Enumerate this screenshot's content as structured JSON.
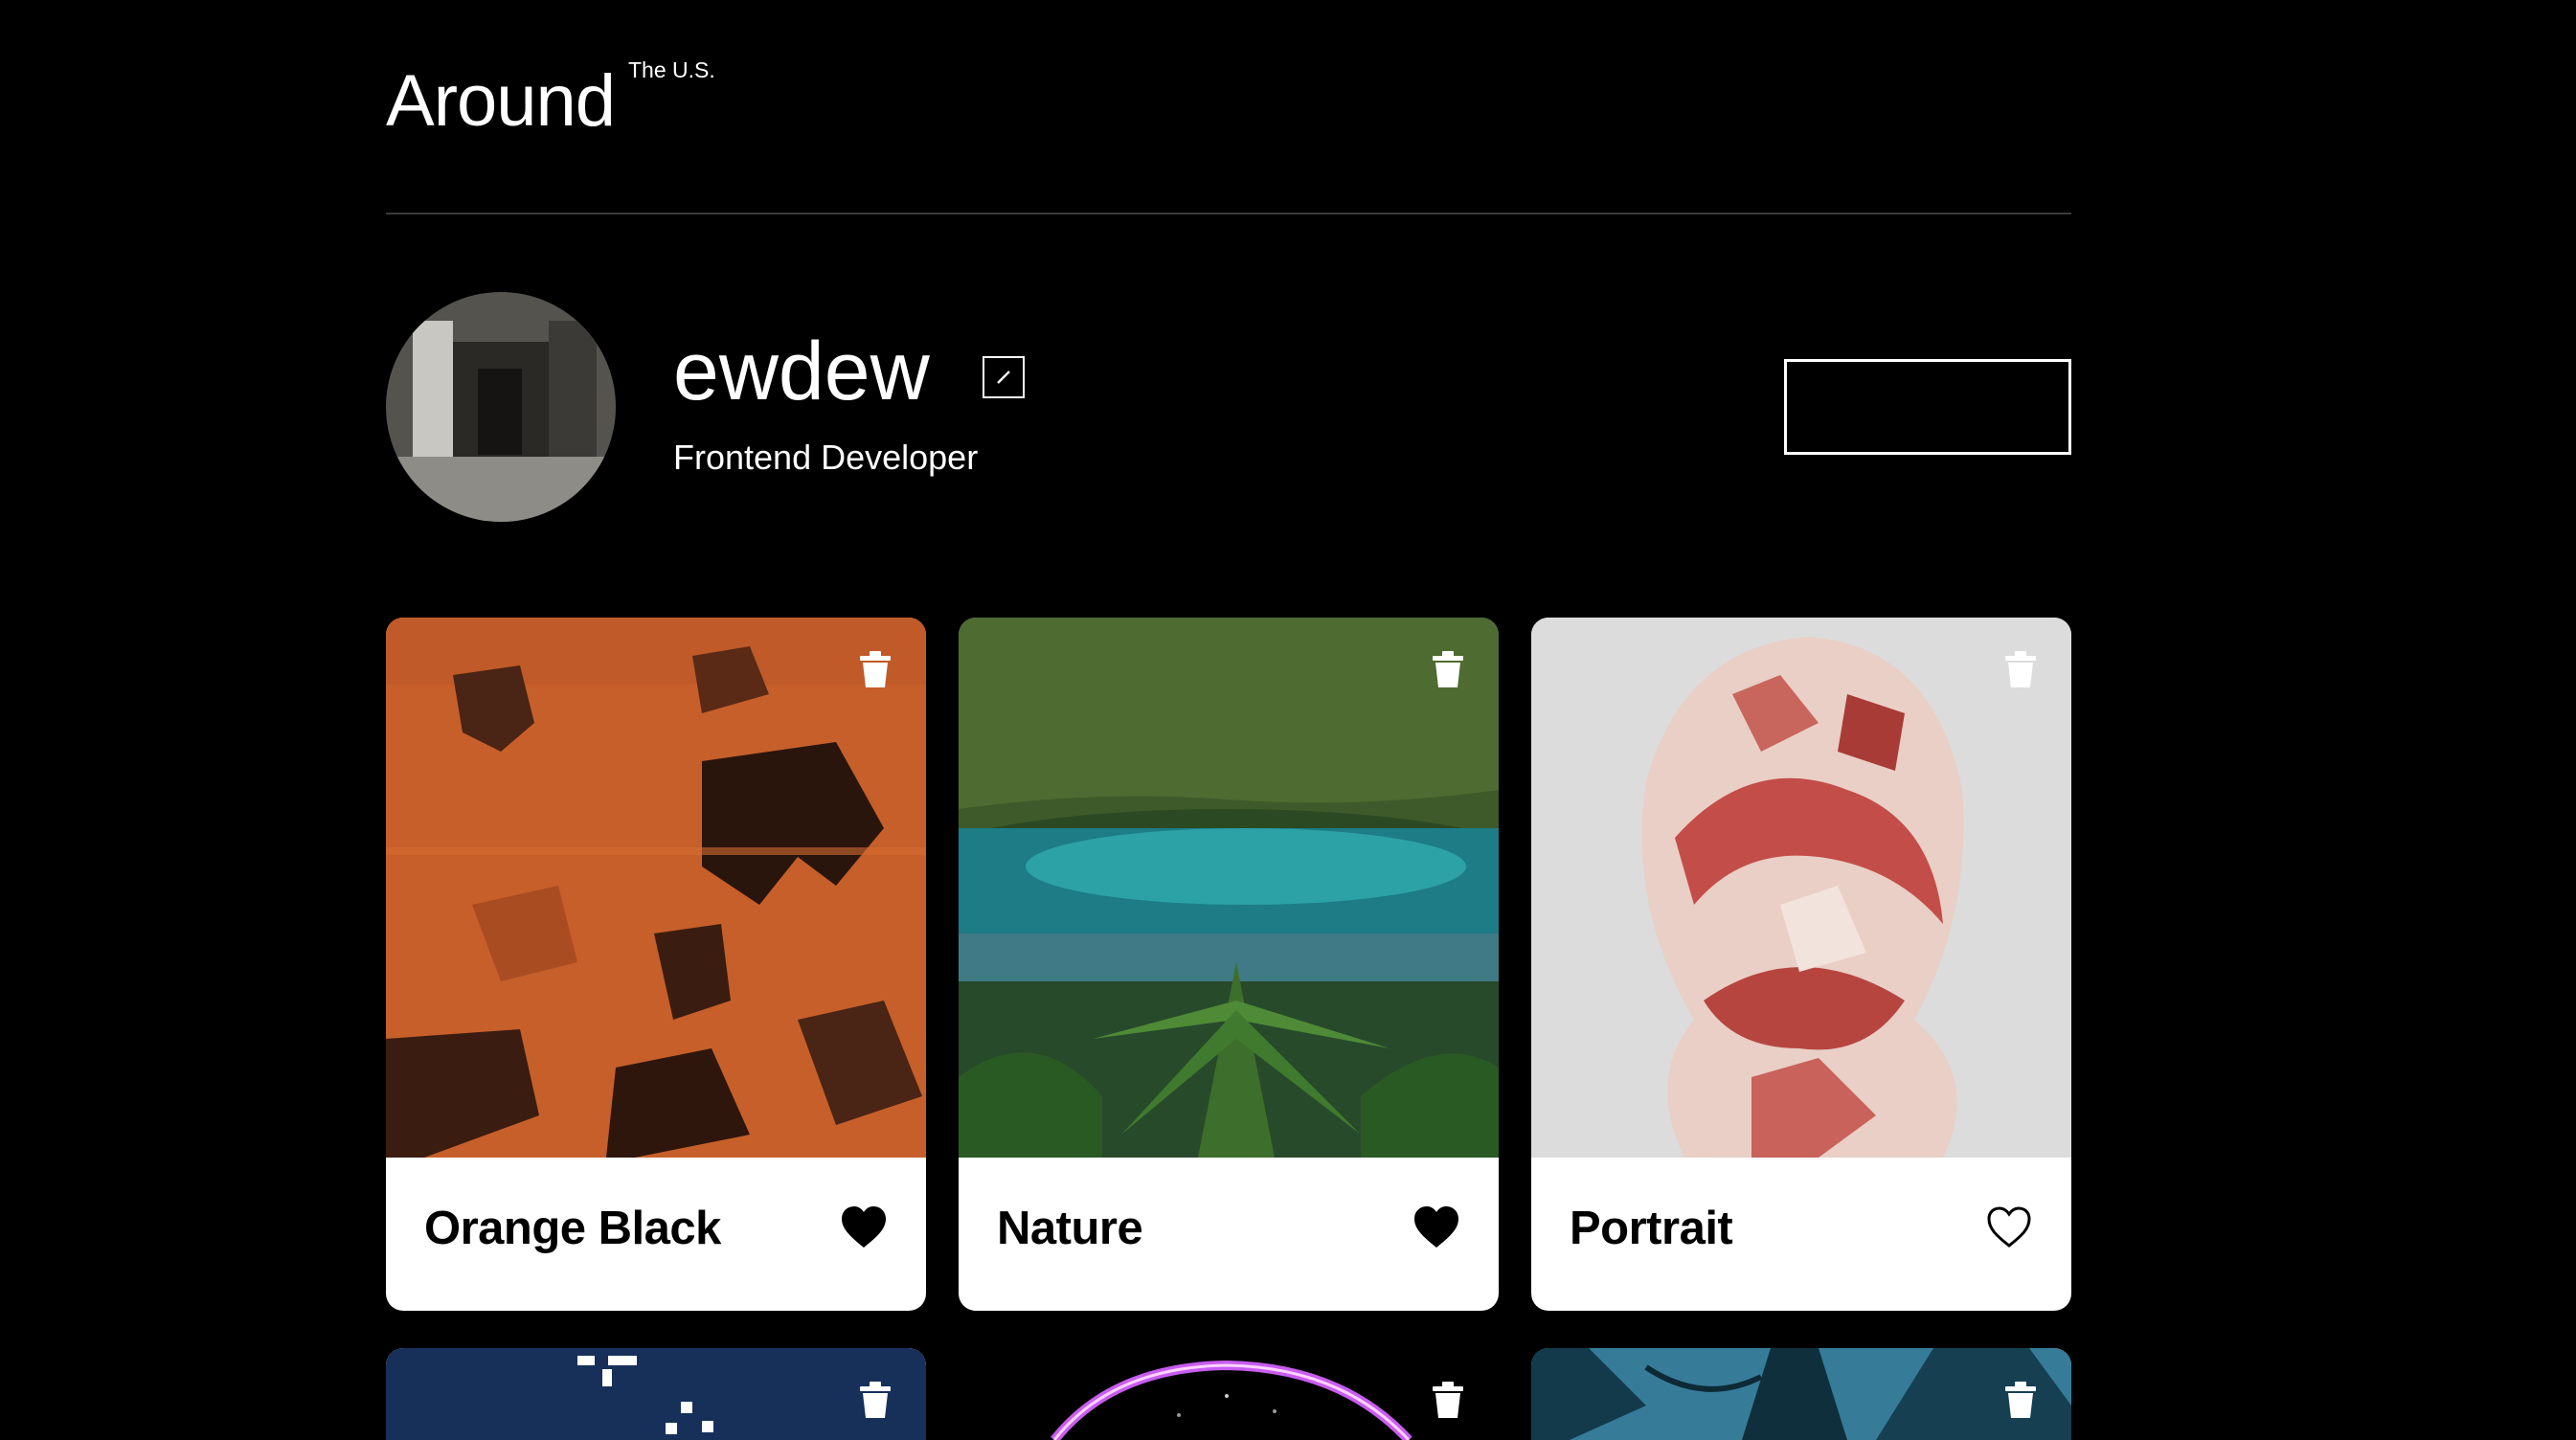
{
  "header": {
    "logo_text": "Around",
    "logo_sup": "The U.S."
  },
  "profile": {
    "name": "ewdew",
    "job": "Frontend Developer",
    "add_label": "+"
  },
  "cards": [
    {
      "title": "Orange Black",
      "liked": true
    },
    {
      "title": "Nature",
      "liked": true
    },
    {
      "title": "Portrait",
      "liked": false
    },
    {
      "title": "",
      "liked": false
    },
    {
      "title": "",
      "liked": false
    },
    {
      "title": "",
      "liked": false
    }
  ],
  "colors": {
    "background": "#000000",
    "card": "#ffffff",
    "text_dark": "#000000"
  }
}
